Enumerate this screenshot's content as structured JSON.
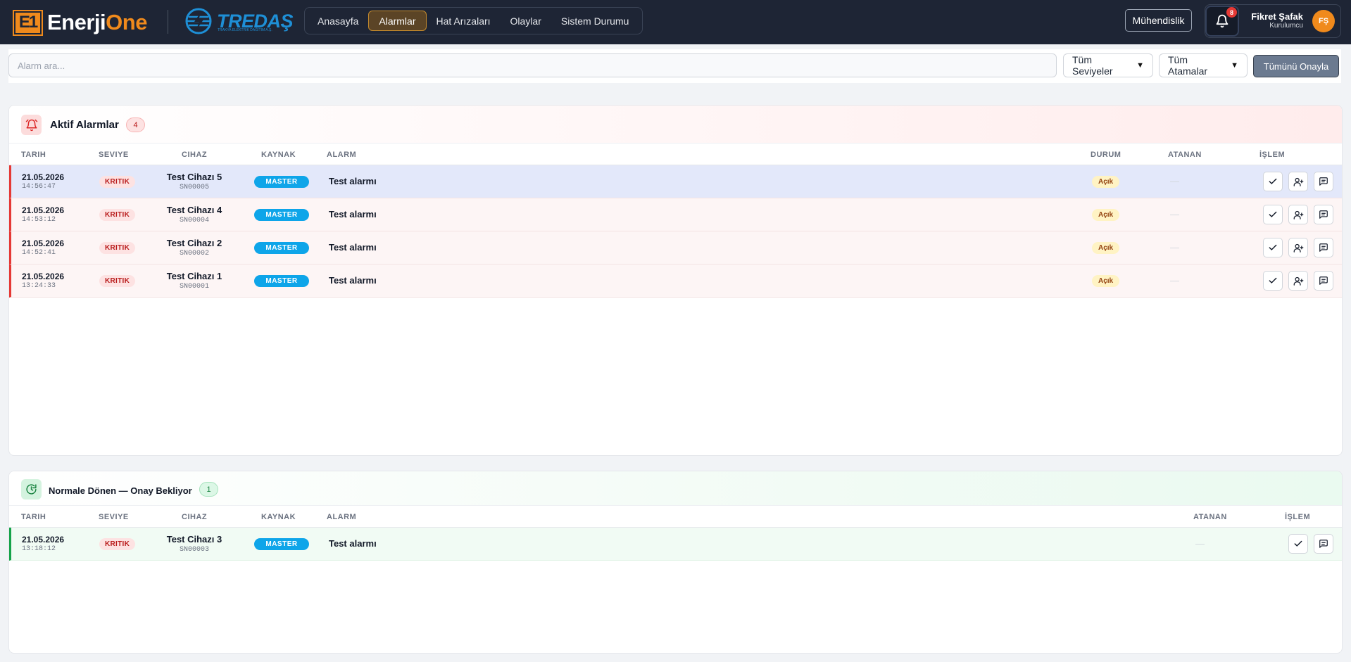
{
  "header": {
    "logo_mark": "E1",
    "logo_word_white": "Enerji",
    "logo_word_orange": "One",
    "partner_logo": "TREDAŞ",
    "partner_subtitle": "TRAKYA ELEKTRİK DAĞITIM A.Ş.",
    "nav": [
      {
        "label": "Anasayfa",
        "active": false
      },
      {
        "label": "Alarmlar",
        "active": true
      },
      {
        "label": "Hat Arızaları",
        "active": false
      },
      {
        "label": "Olaylar",
        "active": false
      },
      {
        "label": "Sistem Durumu",
        "active": false
      }
    ],
    "role_button": "Mühendislik",
    "notification_count": "8",
    "user_name": "Fikret Şafak",
    "user_role": "Kurulumcu",
    "user_initials": "FŞ"
  },
  "filters": {
    "search_placeholder": "Alarm ara...",
    "level_select": "Tüm Seviyeler",
    "assignee_select": "Tüm Atamalar",
    "approve_all": "Tümünü Onayla"
  },
  "active_panel": {
    "title": "Aktif Alarmlar",
    "count": "4",
    "columns": {
      "date": "TARIH",
      "level": "SEVIYE",
      "device": "CIHAZ",
      "source": "KAYNAK",
      "alarm": "ALARM",
      "status": "DURUM",
      "assignee": "ATANAN",
      "action": "İŞLEM"
    },
    "rows": [
      {
        "date": "21.05.2026",
        "time": "14:56:47",
        "level": "KRITIK",
        "device": "Test Cihazı 5",
        "serial": "SN00005",
        "source": "MASTER",
        "alarm": "Test alarmı",
        "status": "Açık",
        "assignee": "—"
      },
      {
        "date": "21.05.2026",
        "time": "14:53:12",
        "level": "KRITIK",
        "device": "Test Cihazı 4",
        "serial": "SN00004",
        "source": "MASTER",
        "alarm": "Test alarmı",
        "status": "Açık",
        "assignee": "—"
      },
      {
        "date": "21.05.2026",
        "time": "14:52:41",
        "level": "KRITIK",
        "device": "Test Cihazı 2",
        "serial": "SN00002",
        "source": "MASTER",
        "alarm": "Test alarmı",
        "status": "Açık",
        "assignee": "—"
      },
      {
        "date": "21.05.2026",
        "time": "13:24:33",
        "level": "KRITIK",
        "device": "Test Cihazı 1",
        "serial": "SN00001",
        "source": "MASTER",
        "alarm": "Test alarmı",
        "status": "Açık",
        "assignee": "—"
      }
    ]
  },
  "normal_panel": {
    "title": "Normale Dönen — Onay Bekliyor",
    "count": "1",
    "columns": {
      "date": "TARIH",
      "level": "SEVIYE",
      "device": "CIHAZ",
      "source": "KAYNAK",
      "alarm": "ALARM",
      "assignee": "ATANAN",
      "action": "İŞLEM"
    },
    "rows": [
      {
        "date": "21.05.2026",
        "time": "13:18:12",
        "level": "KRITIK",
        "device": "Test Cihazı 3",
        "serial": "SN00003",
        "source": "MASTER",
        "alarm": "Test alarmı",
        "assignee": "—"
      }
    ]
  },
  "colors": {
    "header_bg": "#1e2535",
    "brand_orange": "#f08a1c",
    "critical_red": "#e53935",
    "normal_green": "#16a34a",
    "source_blue": "#0ea5e9"
  }
}
